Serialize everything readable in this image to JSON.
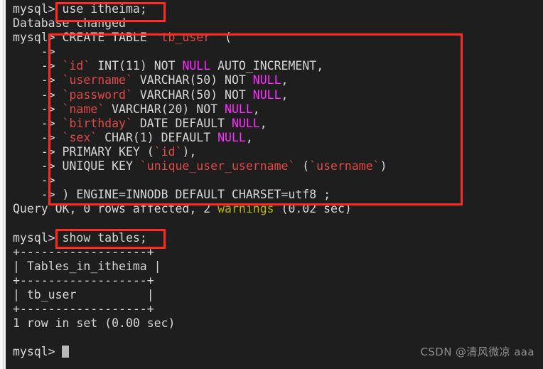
{
  "terminal": {
    "prompt": "mysql>",
    "continuation": "    ->",
    "colors": {
      "background": "#1e1e1e",
      "default_text": "#d6d6d6",
      "identifier": "#e04a45",
      "null_keyword": "#ff2dff",
      "warning": "#b3b300",
      "annotation_box": "#ff2a22",
      "cursor": "#b9b9b9",
      "watermark": "#8e8e8e"
    },
    "lines": [
      {
        "id": "l01",
        "prompt": "mysql> ",
        "segments": [
          {
            "text": "use itheima;",
            "color": "default"
          }
        ]
      },
      {
        "id": "l02",
        "prompt": "",
        "segments": [
          {
            "text": "Database changed",
            "color": "default"
          }
        ]
      },
      {
        "id": "l03",
        "prompt": "mysql> ",
        "segments": [
          {
            "text": "CREATE TABLE  ",
            "color": "default"
          },
          {
            "text": "tb_user",
            "color": "identifier"
          },
          {
            "text": "  (",
            "color": "default"
          }
        ]
      },
      {
        "id": "l04",
        "prompt": "    -> ",
        "segments": [
          {
            "text": "",
            "color": "default"
          }
        ]
      },
      {
        "id": "l05",
        "prompt": "    -> ",
        "segments": [
          {
            "text": "`id`",
            "color": "identifier"
          },
          {
            "text": " INT(11) NOT ",
            "color": "default"
          },
          {
            "text": "NULL",
            "color": "null"
          },
          {
            "text": " AUTO_INCREMENT,",
            "color": "default"
          }
        ]
      },
      {
        "id": "l06",
        "prompt": "    -> ",
        "segments": [
          {
            "text": "`username`",
            "color": "identifier"
          },
          {
            "text": " VARCHAR(50) NOT ",
            "color": "default"
          },
          {
            "text": "NULL",
            "color": "null"
          },
          {
            "text": ",",
            "color": "default"
          }
        ]
      },
      {
        "id": "l07",
        "prompt": "    -> ",
        "segments": [
          {
            "text": "`password`",
            "color": "identifier"
          },
          {
            "text": " VARCHAR(50) NOT ",
            "color": "default"
          },
          {
            "text": "NULL",
            "color": "null"
          },
          {
            "text": ",",
            "color": "default"
          }
        ]
      },
      {
        "id": "l08",
        "prompt": "    -> ",
        "segments": [
          {
            "text": "`name`",
            "color": "identifier"
          },
          {
            "text": " VARCHAR(20) NOT ",
            "color": "default"
          },
          {
            "text": "NULL",
            "color": "null"
          },
          {
            "text": ",",
            "color": "default"
          }
        ]
      },
      {
        "id": "l09",
        "prompt": "    -> ",
        "segments": [
          {
            "text": "`birthday`",
            "color": "identifier"
          },
          {
            "text": " DATE DEFAULT ",
            "color": "default"
          },
          {
            "text": "NULL",
            "color": "null"
          },
          {
            "text": ",",
            "color": "default"
          }
        ]
      },
      {
        "id": "l10",
        "prompt": "    -> ",
        "segments": [
          {
            "text": "`sex`",
            "color": "identifier"
          },
          {
            "text": " CHAR(1) DEFAULT ",
            "color": "default"
          },
          {
            "text": "NULL",
            "color": "null"
          },
          {
            "text": ",",
            "color": "default"
          }
        ]
      },
      {
        "id": "l11",
        "prompt": "    -> ",
        "segments": [
          {
            "text": "PRIMARY KEY (",
            "color": "default"
          },
          {
            "text": "`id`",
            "color": "identifier"
          },
          {
            "text": "),",
            "color": "default"
          }
        ]
      },
      {
        "id": "l12",
        "prompt": "    -> ",
        "segments": [
          {
            "text": "UNIQUE KEY ",
            "color": "default"
          },
          {
            "text": "`unique_user_username`",
            "color": "identifier"
          },
          {
            "text": " (",
            "color": "default"
          },
          {
            "text": "`username`",
            "color": "identifier"
          },
          {
            "text": ")",
            "color": "default"
          }
        ]
      },
      {
        "id": "l13",
        "prompt": "    -> ",
        "segments": [
          {
            "text": "",
            "color": "default"
          }
        ]
      },
      {
        "id": "l14",
        "prompt": "    -> ",
        "segments": [
          {
            "text": ") ENGINE=INNODB DEFAULT CHARSET=utf8 ;",
            "color": "default"
          }
        ]
      },
      {
        "id": "l15",
        "prompt": "",
        "segments": [
          {
            "text": "Query OK, 0 rows affected, 2 ",
            "color": "default"
          },
          {
            "text": "warnings",
            "color": "warning"
          },
          {
            "text": " (0.02 sec)",
            "color": "default"
          }
        ]
      },
      {
        "id": "l16",
        "prompt": "",
        "segments": [
          {
            "text": "",
            "color": "default"
          }
        ]
      },
      {
        "id": "l17",
        "prompt": "mysql> ",
        "segments": [
          {
            "text": "show tables;",
            "color": "default"
          }
        ]
      },
      {
        "id": "l18",
        "prompt": "",
        "segments": [
          {
            "text": "+------------------+",
            "color": "default"
          }
        ]
      },
      {
        "id": "l19",
        "prompt": "",
        "segments": [
          {
            "text": "| Tables_in_itheima |",
            "color": "default"
          }
        ]
      },
      {
        "id": "l20",
        "prompt": "",
        "segments": [
          {
            "text": "+------------------+",
            "color": "default"
          }
        ]
      },
      {
        "id": "l21",
        "prompt": "",
        "segments": [
          {
            "text": "| tb_user          |",
            "color": "default"
          }
        ]
      },
      {
        "id": "l22",
        "prompt": "",
        "segments": [
          {
            "text": "+------------------+",
            "color": "default"
          }
        ]
      },
      {
        "id": "l23",
        "prompt": "",
        "segments": [
          {
            "text": "1 row in set (0.00 sec)",
            "color": "default"
          }
        ]
      },
      {
        "id": "l24",
        "prompt": "",
        "segments": [
          {
            "text": "",
            "color": "default"
          }
        ]
      },
      {
        "id": "l25",
        "prompt": "mysql> ",
        "segments": [
          {
            "text": "",
            "color": "default"
          }
        ]
      }
    ]
  },
  "annotations": [
    {
      "id": "anno-use",
      "label": "use-itheima-highlight",
      "target_text": "use itheima;"
    },
    {
      "id": "anno-create",
      "label": "create-table-highlight",
      "target_text": "CREATE TABLE tb_user ( ... ) ENGINE=INNODB DEFAULT CHARSET=utf8 ;"
    },
    {
      "id": "anno-showtables",
      "label": "show-tables-highlight",
      "target_text": "show tables;"
    }
  ],
  "watermark": {
    "text": "CSDN @清风微凉 aaa"
  }
}
